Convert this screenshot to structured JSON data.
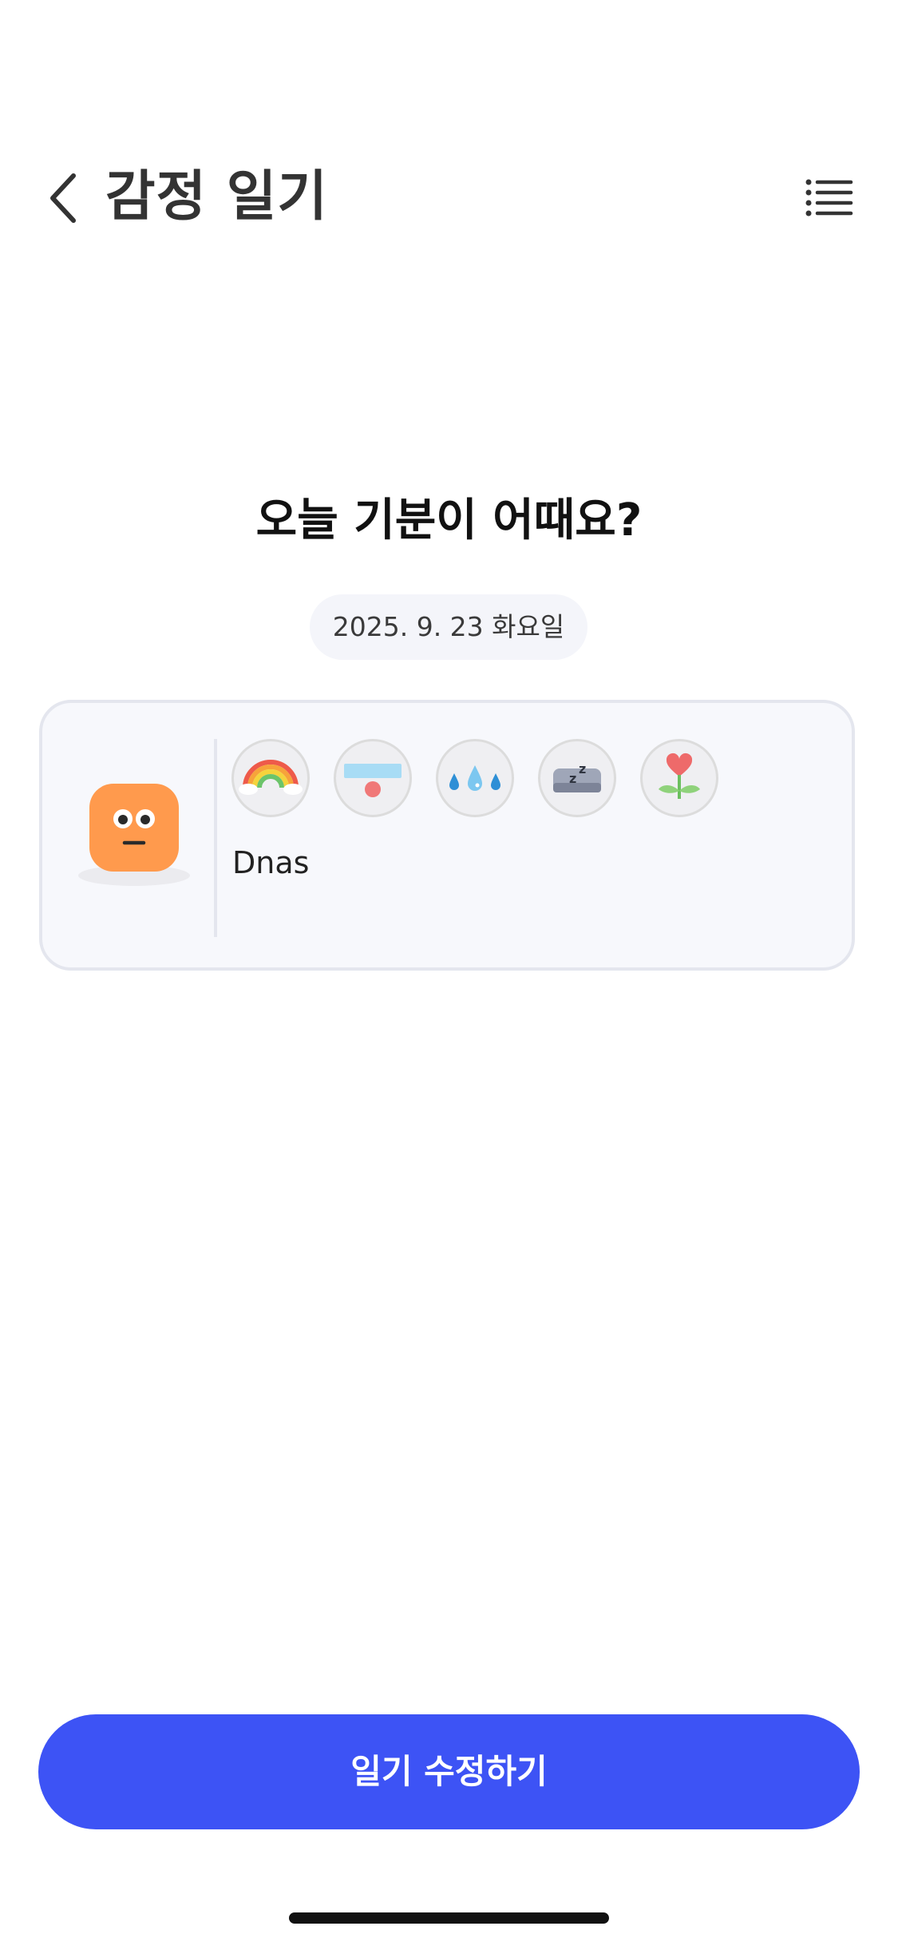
{
  "header": {
    "title": "감정 일기",
    "back_icon": "chevron-left-icon",
    "menu_icon": "list-icon"
  },
  "main": {
    "question": "오늘 기분이 어때요?",
    "date": "2025. 9. 23 화요일"
  },
  "entry": {
    "mood": "neutral-face",
    "activity_icons": [
      "rainbow-icon",
      "shower-icon",
      "rain-drops-icon",
      "sleep-icon",
      "heart-flower-icon"
    ],
    "text": "Dnas"
  },
  "footer": {
    "edit_label": "일기 수정하기"
  },
  "colors": {
    "accent": "#3d53f5",
    "mood_orange": "#ff9a4d",
    "card_bg": "#f7f8fc",
    "card_border": "#e4e6ee"
  }
}
